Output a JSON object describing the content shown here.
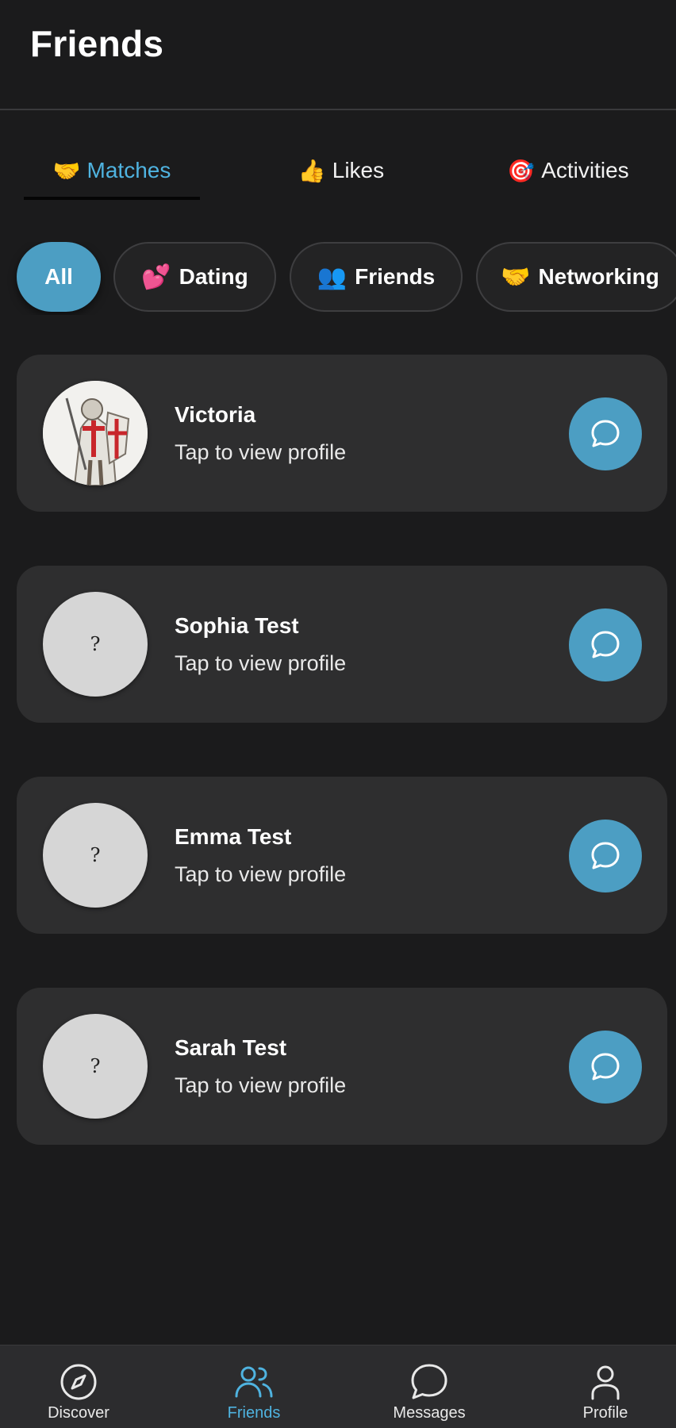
{
  "header": {
    "title": "Friends"
  },
  "tabs": [
    {
      "emoji": "🤝",
      "label": "Matches",
      "active": true
    },
    {
      "emoji": "👍",
      "label": "Likes",
      "active": false
    },
    {
      "emoji": "🎯",
      "label": "Activities",
      "active": false
    }
  ],
  "filters": [
    {
      "emoji": "",
      "label": "All",
      "active": true
    },
    {
      "emoji": "💕",
      "label": "Dating",
      "active": false
    },
    {
      "emoji": "👥",
      "label": "Friends",
      "active": false
    },
    {
      "emoji": "🤝",
      "label": "Networking",
      "active": false
    }
  ],
  "matches": [
    {
      "name": "Victoria",
      "subtitle": "Tap to view profile",
      "avatar": "photo",
      "placeholder": ""
    },
    {
      "name": "Sophia Test",
      "subtitle": "Tap to view profile",
      "avatar": "placeholder",
      "placeholder": "?"
    },
    {
      "name": "Emma Test",
      "subtitle": "Tap to view profile",
      "avatar": "placeholder",
      "placeholder": "?"
    },
    {
      "name": "Sarah Test",
      "subtitle": "Tap to view profile",
      "avatar": "placeholder",
      "placeholder": "?"
    }
  ],
  "bottom_nav": [
    {
      "label": "Discover",
      "icon": "compass-icon",
      "active": false
    },
    {
      "label": "Friends",
      "icon": "people-icon",
      "active": true
    },
    {
      "label": "Messages",
      "icon": "chat-bubble-icon",
      "active": false
    },
    {
      "label": "Profile",
      "icon": "person-icon",
      "active": false
    }
  ],
  "colors": {
    "background": "#1b1b1c",
    "card": "#2e2e2f",
    "accent": "#4c9ec3",
    "accent_text": "#4fb3e0"
  }
}
